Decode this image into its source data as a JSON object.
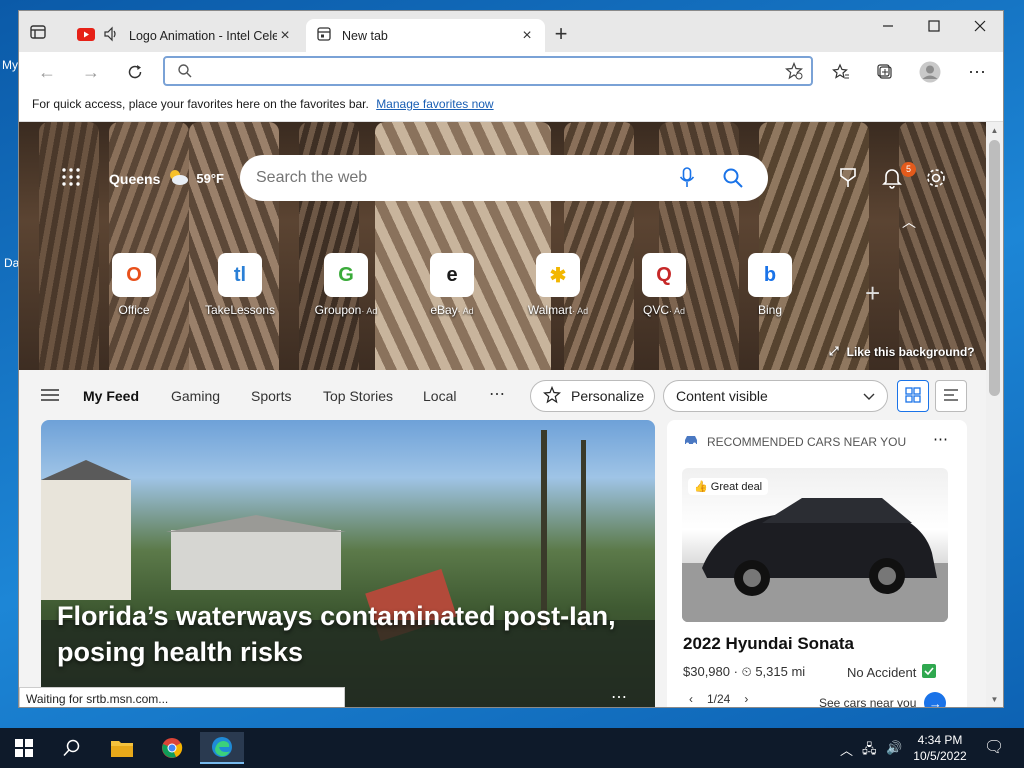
{
  "desktop": {
    "frag_top": "My",
    "frag_mid": "Da"
  },
  "tabs": [
    {
      "title": "Logo Animation - Intel Cele",
      "icon": "youtube-icon",
      "audio": true
    },
    {
      "title": "New tab",
      "icon": "newtab-icon"
    }
  ],
  "address": {
    "value": "",
    "placeholder": ""
  },
  "favbar": {
    "text": "For quick access, place your favorites here on the favorites bar.",
    "link": "Manage favorites now"
  },
  "hero": {
    "city": "Queens",
    "temp": "59°F",
    "search_placeholder": "Search the web",
    "notifications": "5",
    "like_background": "Like this background?"
  },
  "tiles": [
    {
      "label": "Office",
      "ad": "",
      "glyph": "O",
      "color": "#e8501b"
    },
    {
      "label": "TakeLessons",
      "ad": "",
      "glyph": "tl",
      "color": "#2a7fd6"
    },
    {
      "label": "Groupon",
      "ad": "· Ad",
      "glyph": "G",
      "color": "#3aab3a"
    },
    {
      "label": "eBay",
      "ad": "· Ad",
      "glyph": "e",
      "color": "#1b1b1b"
    },
    {
      "label": "Walmart",
      "ad": "· Ad",
      "glyph": "✱",
      "color": "#f2b600"
    },
    {
      "label": "QVC",
      "ad": "· Ad",
      "glyph": "Q",
      "color": "#c62828"
    },
    {
      "label": "Bing",
      "ad": "",
      "glyph": "b",
      "color": "#1a73e8"
    }
  ],
  "feed": {
    "tabs": [
      "My Feed",
      "Gaming",
      "Sports",
      "Top Stories",
      "Local"
    ],
    "personalize": "Personalize",
    "content_visible": "Content visible"
  },
  "news": {
    "headline": "Florida’s waterways contaminated post-Ian, posing health risks"
  },
  "cars": {
    "header": "RECOMMENDED CARS NEAR YOU",
    "deal": "Great deal",
    "name": "2022 Hyundai Sonata",
    "price": "$30,980",
    "miles": "5,315 mi",
    "accident": "No Accident",
    "page": "1/24",
    "see": "See cars near you"
  },
  "status": "Waiting for srtb.msn.com...",
  "clock": {
    "time": "4:34 PM",
    "date": "10/5/2022"
  }
}
